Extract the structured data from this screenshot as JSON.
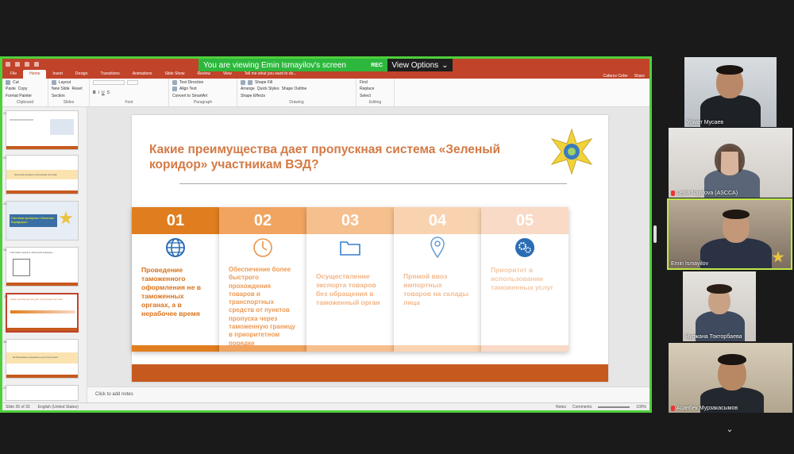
{
  "screen_share": {
    "banner_text": "You are viewing Emin Ismayilov's screen",
    "rec_label": "REC",
    "view_options_label": "View Options",
    "view_options_icon": "chevron-down-icon"
  },
  "ppt": {
    "tabs": [
      "File",
      "Home",
      "Insert",
      "Design",
      "Transitions",
      "Animations",
      "Slide Show",
      "Review",
      "View",
      "Tell me what you want to do..."
    ],
    "active_tab": "Home",
    "user": "Cafarov Cefer",
    "share_label": "Share",
    "ribbon": {
      "clipboard": {
        "paste": "Paste",
        "cut": "Cut",
        "copy": "Copy",
        "format_painter": "Format Painter",
        "group": "Clipboard"
      },
      "slides": {
        "new_slide": "New Slide",
        "layout": "Layout",
        "reset": "Reset",
        "section": "Section",
        "group": "Slides"
      },
      "font": {
        "group": "Font"
      },
      "paragraph": {
        "text_direction": "Text Direction",
        "align_text": "Align Text",
        "smartart": "Convert to SmartArt",
        "group": "Paragraph"
      },
      "drawing": {
        "arrange": "Arrange",
        "quick_styles": "Quick Styles",
        "shape_fill": "Shape Fill",
        "shape_outline": "Shape Outline",
        "shape_effects": "Shape Effects",
        "group": "Drawing"
      },
      "editing": {
        "find": "Find",
        "replace": "Replace",
        "select": "Select",
        "group": "Editing"
      }
    },
    "thumbnails": [
      {
        "num": "21",
        "text": ""
      },
      {
        "num": "22",
        "text": "Зеленый коридор пропускная система"
      },
      {
        "num": "23",
        "text": "Система пропуска «Зеленые Коридоры»"
      },
      {
        "num": "24",
        "text": "Участники проекта «Зеленый коридор»"
      },
      {
        "num": "25",
        "text": "Какие преимущества дает пропускная система"
      },
      {
        "num": "26",
        "text": "Необходимые документы для получения"
      },
      {
        "num": "27",
        "text": ""
      }
    ],
    "slide": {
      "title": "Какие преимущества дает пропускная система «Зеленый коридор» участникам ВЭД?",
      "columns": [
        {
          "num": "01",
          "icon": "globe-icon",
          "text": "Проведение таможенного оформления не в таможенных органах, а в нерабочее время"
        },
        {
          "num": "02",
          "icon": "clock-icon",
          "text": "Обеспечение более быстрого прохождения товаров и транспортных средств от пунктов пропуска через таможенную границу в приоритетном порядке"
        },
        {
          "num": "03",
          "icon": "folder-icon",
          "text": "Осуществление экспорта товаров без обращения в таможенный орган"
        },
        {
          "num": "04",
          "icon": "location-pin-icon",
          "text": "Прямой ввоз импортных товаров на склады лица"
        },
        {
          "num": "05",
          "icon": "gears-icon",
          "text": "Приоритет в использовании таможенных услуг"
        }
      ]
    },
    "notes_placeholder": "Click to add notes",
    "status": {
      "slide_counter": "Slide 26 of 33",
      "language": "English (United States)",
      "notes_btn": "Notes",
      "comments_btn": "Comments",
      "zoom": "100%"
    }
  },
  "participants": [
    {
      "name": "Урмат Мусаев",
      "muted": false,
      "active": false
    },
    {
      "name": "Leyla Najafova (ASCCA)",
      "muted": true,
      "active": false
    },
    {
      "name": "Emin Ismayilov",
      "muted": false,
      "active": true
    },
    {
      "name": "Нуржана Токторбаева",
      "muted": false,
      "active": false
    },
    {
      "name": "Асанбек Мурзакасымов",
      "muted": true,
      "active": false
    }
  ],
  "colors": {
    "share_border": "#4fcf3c",
    "ppt_accent": "#c0432a",
    "col1": "#e07e1f",
    "col2": "#f0a460",
    "col3": "#f6bf8e",
    "col4": "#f9d3b0",
    "col5": "#f9dac6",
    "active_speaker": "#bfe84a"
  },
  "scroll_down_icon": "chevron-down-icon"
}
